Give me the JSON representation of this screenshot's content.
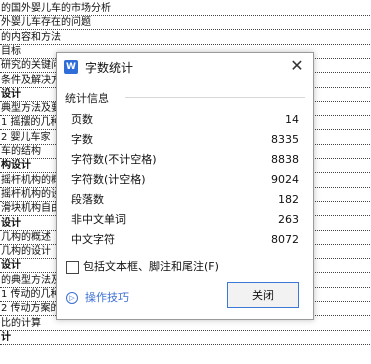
{
  "document": {
    "lines": [
      {
        "text": "的国外婴儿车的市场分析",
        "bold": false
      },
      {
        "text": "外婴儿车存在的问题",
        "bold": false
      },
      {
        "text": "的内容和方法",
        "bold": false
      },
      {
        "text": "目标",
        "bold": false
      },
      {
        "text": "研究的关键问题及解决思路",
        "bold": false
      },
      {
        "text": "条件及解决方案",
        "bold": false
      },
      {
        "text": "设计",
        "bold": true
      },
      {
        "text": "典型方法及要",
        "bold": false
      },
      {
        "text": "1 摇摆的几种",
        "bold": false
      },
      {
        "text": "2 婴儿车家",
        "bold": false
      },
      {
        "text": "车的结构",
        "bold": false
      },
      {
        "text": "构设计",
        "bold": true
      },
      {
        "text": "摇杆机构的概",
        "bold": false
      },
      {
        "text": "摇杆机构的设",
        "bold": false
      },
      {
        "text": "滑块机构自由",
        "bold": false
      },
      {
        "text": "设计",
        "bold": true
      },
      {
        "text": "几构的概述",
        "bold": false
      },
      {
        "text": "几构的设计",
        "bold": false
      },
      {
        "text": "设计",
        "bold": true
      },
      {
        "text": "的典型方法及",
        "bold": false
      },
      {
        "text": "1 传动的几种",
        "bold": false
      },
      {
        "text": "2 传动方案的",
        "bold": false
      },
      {
        "text": "比的计算",
        "bold": false
      },
      {
        "text": "计",
        "bold": true
      }
    ]
  },
  "dialog": {
    "app_icon_letter": "W",
    "title": "字数统计",
    "close_icon_glyph": "✕",
    "group_label": "统计信息",
    "stats": [
      {
        "label": "页数",
        "value": "14"
      },
      {
        "label": "字数",
        "value": "8335"
      },
      {
        "label": "字符数(不计空格)",
        "value": "8838"
      },
      {
        "label": "字符数(计空格)",
        "value": "9024"
      },
      {
        "label": "段落数",
        "value": "182"
      },
      {
        "label": "非中文单词",
        "value": "263"
      },
      {
        "label": "中文字符",
        "value": "8072"
      }
    ],
    "checkbox_label": "包括文本框、脚注和尾注(F)",
    "checkbox_checked": false,
    "tips_label": "操作技巧",
    "tips_icon_glyph": "▷",
    "close_button_label": "关闭",
    "accent_color": "#3c78d8",
    "link_color": "#3b6fd4"
  }
}
